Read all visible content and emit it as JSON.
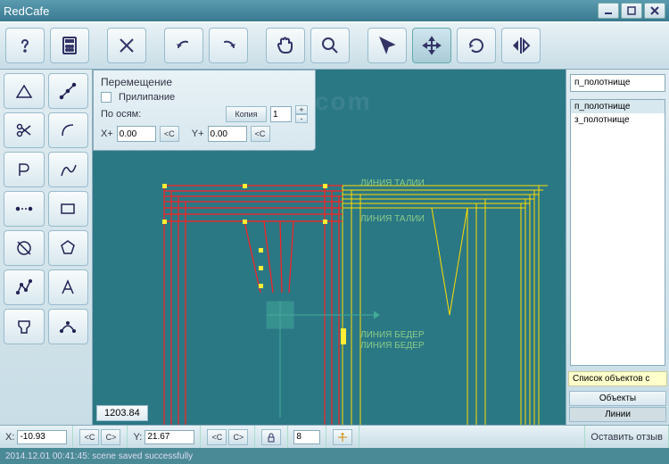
{
  "app": {
    "title": "RedCafe"
  },
  "watermark": "RedCafeStore.com",
  "move_panel": {
    "title": "Перемещение",
    "snap_label": "Прилипание",
    "axes_label": "По осям:",
    "copy_label": "Копия",
    "copy_value": "1",
    "x_label": "X+",
    "x_value": "0.00",
    "y_label": "Y+",
    "y_value": "0.00",
    "btn_c": "<C",
    "btn_plus": "+",
    "btn_minus": "-"
  },
  "canvas": {
    "coord_label": "1203.84",
    "text_talii": "ЛИНИЯ ТАЛИИ",
    "text_beder": "ЛИНИЯ БЕДЕР"
  },
  "right": {
    "filter": "п_полотнище",
    "items": [
      "п_полотнище",
      "з_полотнище"
    ],
    "tooltip": "Список объектов с",
    "tab_objects": "Объекты",
    "tab_lines": "Линии"
  },
  "status": {
    "x_label": "X:",
    "x_value": "-10.93",
    "y_label": "Y:",
    "y_value": "21.67",
    "btn_c1": "<C",
    "btn_c2": "C>",
    "zoom": "8",
    "feedback": "Оставить отзыв"
  },
  "message": "2014.12.01 00:41:45: scene saved successfully"
}
